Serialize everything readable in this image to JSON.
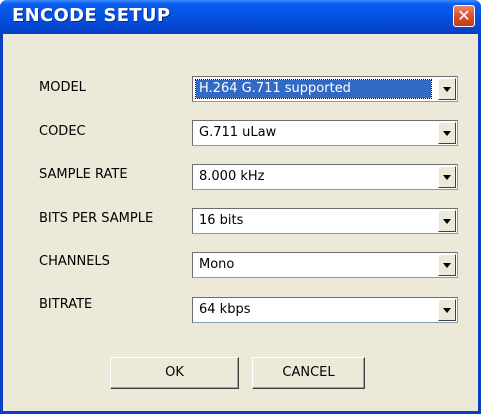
{
  "window": {
    "title": "ENCODE SETUP",
    "close_glyph": "✕"
  },
  "fields": [
    {
      "label": "MODEL",
      "value": "H.264 G.711 supported",
      "selected": true
    },
    {
      "label": "CODEC",
      "value": "G.711 uLaw",
      "selected": false
    },
    {
      "label": "SAMPLE RATE",
      "value": "8.000 kHz",
      "selected": false
    },
    {
      "label": "BITS PER SAMPLE",
      "value": "16 bits",
      "selected": false
    },
    {
      "label": "CHANNELS",
      "value": "Mono",
      "selected": false
    },
    {
      "label": "BITRATE",
      "value": "64 kbps",
      "selected": false
    }
  ],
  "buttons": {
    "ok_label": "OK",
    "cancel_label": "CANCEL"
  },
  "colors": {
    "titlebar": "#0553e3",
    "dialog_bg": "#ece9d8",
    "selection": "#316ac5",
    "close_button": "#d9502a"
  }
}
